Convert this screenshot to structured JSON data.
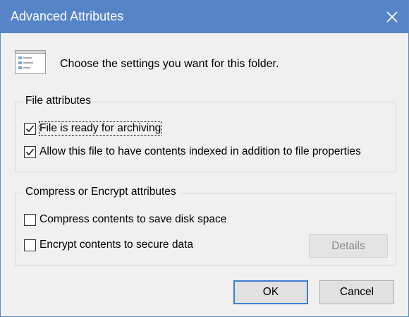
{
  "window": {
    "title": "Advanced Attributes",
    "titlebar_color": "#5585c8"
  },
  "header": {
    "text": "Choose the settings you want for this folder.",
    "icon": "folder-settings-icon"
  },
  "file_attributes": {
    "label": "File attributes",
    "options": [
      {
        "label": "File is ready for archiving",
        "checked": true
      },
      {
        "label": "Allow this file to have contents indexed in addition to file properties",
        "checked": true
      }
    ]
  },
  "compress_encrypt": {
    "label": "Compress or Encrypt attributes",
    "options": [
      {
        "label": "Compress contents to save disk space",
        "checked": false
      },
      {
        "label": "Encrypt contents to secure data",
        "checked": false
      }
    ],
    "details_label": "Details",
    "details_enabled": false
  },
  "buttons": {
    "ok": "OK",
    "cancel": "Cancel"
  }
}
